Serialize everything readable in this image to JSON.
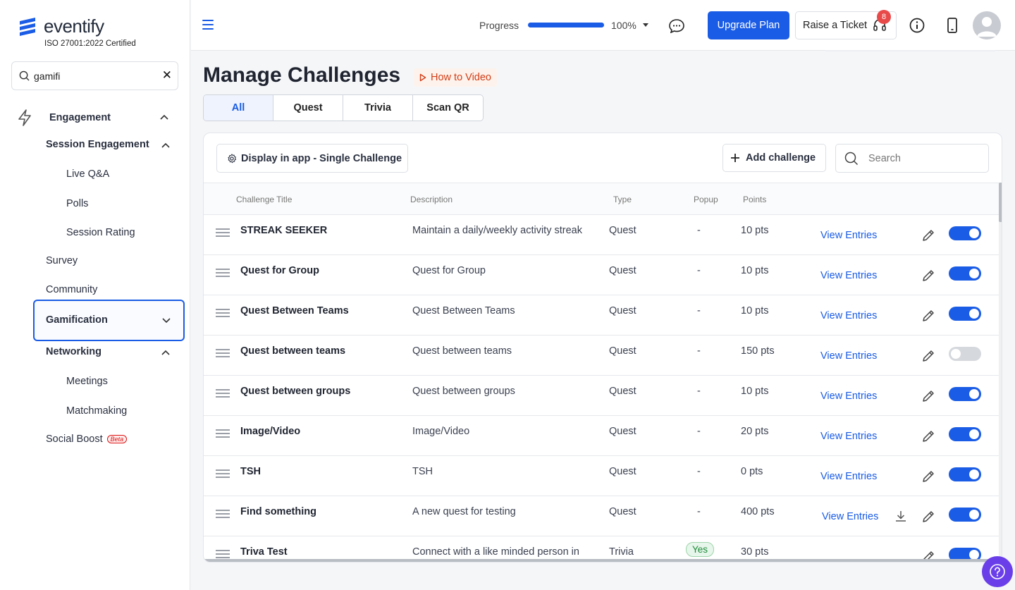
{
  "brand": {
    "name": "eventify",
    "certification": "ISO 27001:2022 Certified"
  },
  "sidebar": {
    "search_value": "gamifi",
    "items": [
      {
        "label": "Engagement"
      },
      {
        "label": "Session Engagement"
      },
      {
        "label": "Live Q&A"
      },
      {
        "label": "Polls"
      },
      {
        "label": "Session Rating"
      },
      {
        "label": "Survey"
      },
      {
        "label": "Community"
      },
      {
        "label": "Gamification"
      },
      {
        "label": "Networking"
      },
      {
        "label": "Meetings"
      },
      {
        "label": "Matchmaking"
      },
      {
        "label": "Social Boost"
      }
    ],
    "beta_badge": "Beta"
  },
  "topbar": {
    "progress_label": "Progress",
    "progress_value": 100,
    "progress_text": "100%",
    "upgrade_label": "Upgrade Plan",
    "ticket_label": "Raise a Ticket",
    "notification_count": "8"
  },
  "main": {
    "title": "Manage Challenges",
    "how_to": "How to Video",
    "tabs": [
      {
        "label": "All",
        "active": true
      },
      {
        "label": "Quest",
        "active": false
      },
      {
        "label": "Trivia",
        "active": false
      },
      {
        "label": "Scan QR",
        "active": false
      }
    ],
    "display_button": "Display in app - Single Challenge",
    "add_button": "Add challenge",
    "search_placeholder": "Search",
    "columns": [
      "Challenge Title",
      "Description",
      "Type",
      "Popup",
      "Points"
    ],
    "view_entries_label": "View Entries",
    "rows": [
      {
        "title": "STREAK SEEKER",
        "description": "Maintain a daily/weekly activity streak",
        "type": "Quest",
        "popup": "-",
        "points": "10 pts",
        "enabled": true,
        "download": false
      },
      {
        "title": "Quest for Group",
        "description": "Quest for Group",
        "type": "Quest",
        "popup": "-",
        "points": "10 pts",
        "enabled": true,
        "download": false
      },
      {
        "title": "Quest Between Teams",
        "description": "Quest Between Teams",
        "type": "Quest",
        "popup": "-",
        "points": "10 pts",
        "enabled": true,
        "download": false
      },
      {
        "title": "Quest between teams",
        "description": "Quest between teams",
        "type": "Quest",
        "popup": "-",
        "points": "150 pts",
        "enabled": false,
        "download": false
      },
      {
        "title": "Quest between groups",
        "description": "Quest between groups",
        "type": "Quest",
        "popup": "-",
        "points": "10 pts",
        "enabled": true,
        "download": false
      },
      {
        "title": "Image/Video",
        "description": "Image/Video",
        "type": "Quest",
        "popup": "-",
        "points": "20 pts",
        "enabled": true,
        "download": false
      },
      {
        "title": "TSH",
        "description": "TSH",
        "type": "Quest",
        "popup": "-",
        "points": "0 pts",
        "enabled": true,
        "download": false
      },
      {
        "title": "Find something",
        "description": "A new quest for testing",
        "type": "Quest",
        "popup": "-",
        "points": "400 pts",
        "enabled": true,
        "download": true
      },
      {
        "title": "Triva Test",
        "description": "Connect with a like minded person in",
        "type": "Trivia",
        "popup": "Yes",
        "points": "30 pts",
        "enabled": true,
        "download": false
      }
    ]
  },
  "colors": {
    "accent": "#1a5ce5",
    "help_fab": "#6a3ee8",
    "how_to": "#d23c16",
    "badge": "#e84a4a"
  }
}
